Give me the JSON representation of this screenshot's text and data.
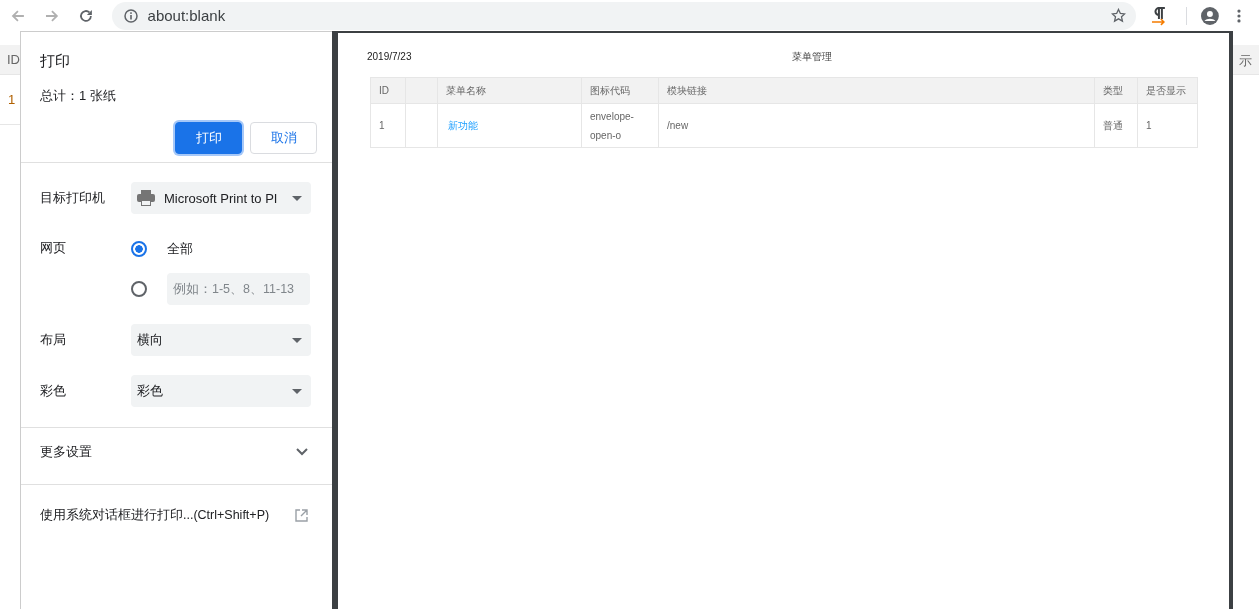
{
  "browser": {
    "url": "about:blank"
  },
  "background_page": {
    "left_header": "ID",
    "left_cell": "1",
    "right_header": "示"
  },
  "print_panel": {
    "title": "打印",
    "summary": "总计：1 张纸",
    "buttons": [
      {
        "label": "打印",
        "kind": "primary"
      },
      {
        "label": "取消",
        "kind": "secondary"
      }
    ],
    "destination": {
      "label": "目标打印机",
      "value": "Microsoft Print to PI"
    },
    "pages": {
      "label": "网页",
      "options": [
        {
          "kind": "text",
          "label": "全部",
          "selected": true
        },
        {
          "kind": "range",
          "placeholder": "例如：1-5、8、11-13",
          "selected": false
        }
      ]
    },
    "layout": {
      "label": "布局",
      "value": "横向"
    },
    "color": {
      "label": "彩色",
      "value": "彩色"
    },
    "more_settings": {
      "label": "更多设置",
      "expanded": false
    },
    "system_dialog": {
      "label": "使用系统对话框进行打印...(Ctrl+Shift+P)"
    }
  },
  "preview": {
    "date": "2019/7/23",
    "title": "菜单管理",
    "table": {
      "columns": [
        {
          "label": "ID"
        },
        {},
        {
          "label": "菜单名称"
        },
        {
          "label": "图标代码"
        },
        {
          "label": "模块链接"
        },
        {
          "label": "类型"
        },
        {
          "label": "是否显示"
        }
      ],
      "rows": [
        {
          "cells": [
            {
              "text": "1"
            },
            {},
            {
              "text": "新功能",
              "kind": "link"
            },
            {
              "text": "envelope-open-o"
            },
            {
              "text": "/new"
            },
            {
              "text": "普通"
            },
            {
              "text": "1"
            }
          ]
        }
      ]
    }
  }
}
